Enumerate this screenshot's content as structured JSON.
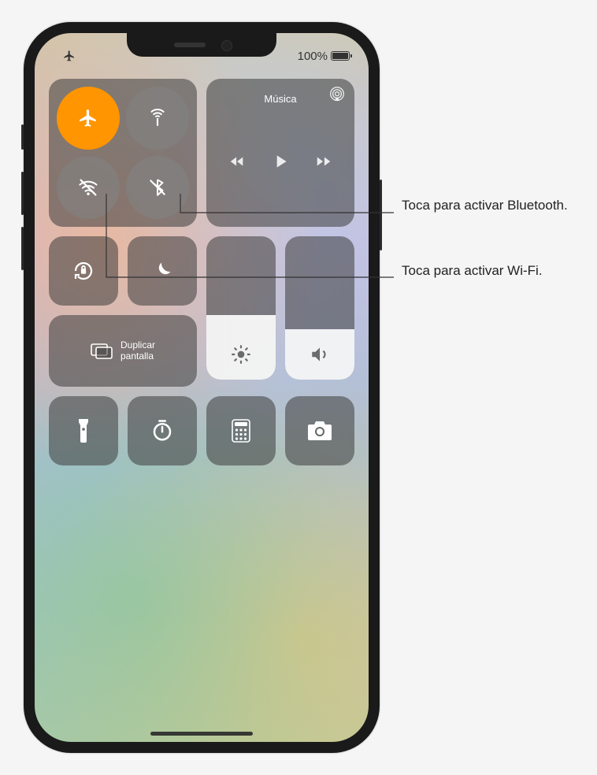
{
  "status": {
    "battery_pct": "100%",
    "airplane_icon": "airplane-icon"
  },
  "connectivity": {
    "airplane": {
      "name": "airplane-mode-toggle",
      "active": true,
      "icon": "airplane-icon"
    },
    "cellular": {
      "name": "cellular-data-toggle",
      "active": false,
      "icon": "cellular-antenna-icon"
    },
    "wifi": {
      "name": "wifi-toggle",
      "active": false,
      "icon": "wifi-off-icon"
    },
    "bluetooth": {
      "name": "bluetooth-toggle",
      "active": false,
      "icon": "bluetooth-off-icon"
    }
  },
  "music": {
    "title": "Música",
    "airplay_icon": "airplay-icon",
    "prev_icon": "prev-track-icon",
    "play_icon": "play-icon",
    "next_icon": "next-track-icon"
  },
  "rotation_lock": {
    "name": "rotation-lock-button",
    "icon": "rotation-lock-icon"
  },
  "dnd": {
    "name": "do-not-disturb-button",
    "icon": "moon-icon"
  },
  "brightness": {
    "name": "brightness-slider",
    "icon": "sun-icon",
    "fill_pct": 45
  },
  "volume": {
    "name": "volume-slider",
    "icon": "speaker-icon",
    "fill_pct": 35
  },
  "screen_mirror": {
    "name": "screen-mirroring-button",
    "icon": "screen-mirror-icon",
    "label_line1": "Duplicar",
    "label_line2": "pantalla"
  },
  "bottom_row": {
    "flashlight": {
      "name": "flashlight-button",
      "icon": "flashlight-icon"
    },
    "timer": {
      "name": "timer-button",
      "icon": "timer-icon"
    },
    "calculator": {
      "name": "calculator-button",
      "icon": "calculator-icon"
    },
    "camera": {
      "name": "camera-button",
      "icon": "camera-icon"
    }
  },
  "callouts": {
    "bluetooth": "Toca para activar Bluetooth.",
    "wifi": "Toca para activar Wi-Fi."
  }
}
